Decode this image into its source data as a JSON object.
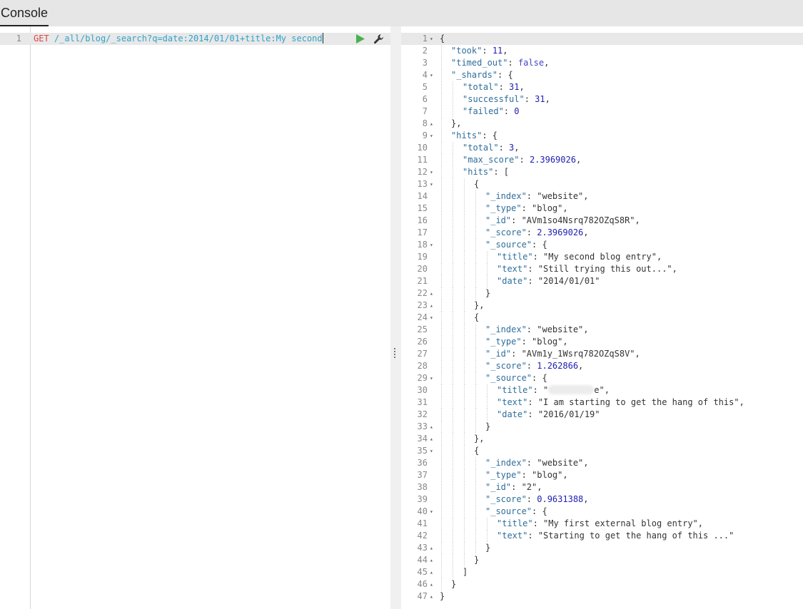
{
  "header": {
    "tab_label": "Console"
  },
  "request": {
    "line_number": "1",
    "method": "GET",
    "url": "/_all/blog/_search?q=date:2014/01/01+title:My second",
    "run_icon": "play-icon",
    "settings_icon": "wrench-icon"
  },
  "response": {
    "lines": [
      {
        "n": "1",
        "fold": "▾",
        "depth": 0,
        "tokens": [
          {
            "t": "p",
            "v": "{"
          }
        ]
      },
      {
        "n": "2",
        "depth": 1,
        "tokens": [
          {
            "t": "k",
            "v": "\"took\""
          },
          {
            "t": "p",
            "v": ": "
          },
          {
            "t": "n",
            "v": "11"
          },
          {
            "t": "p",
            "v": ","
          }
        ]
      },
      {
        "n": "3",
        "depth": 1,
        "tokens": [
          {
            "t": "k",
            "v": "\"timed_out\""
          },
          {
            "t": "p",
            "v": ": "
          },
          {
            "t": "b",
            "v": "false"
          },
          {
            "t": "p",
            "v": ","
          }
        ]
      },
      {
        "n": "4",
        "fold": "▾",
        "depth": 1,
        "tokens": [
          {
            "t": "k",
            "v": "\"_shards\""
          },
          {
            "t": "p",
            "v": ": {"
          }
        ]
      },
      {
        "n": "5",
        "depth": 2,
        "tokens": [
          {
            "t": "k",
            "v": "\"total\""
          },
          {
            "t": "p",
            "v": ": "
          },
          {
            "t": "n",
            "v": "31"
          },
          {
            "t": "p",
            "v": ","
          }
        ]
      },
      {
        "n": "6",
        "depth": 2,
        "tokens": [
          {
            "t": "k",
            "v": "\"successful\""
          },
          {
            "t": "p",
            "v": ": "
          },
          {
            "t": "n",
            "v": "31"
          },
          {
            "t": "p",
            "v": ","
          }
        ]
      },
      {
        "n": "7",
        "depth": 2,
        "tokens": [
          {
            "t": "k",
            "v": "\"failed\""
          },
          {
            "t": "p",
            "v": ": "
          },
          {
            "t": "n",
            "v": "0"
          }
        ]
      },
      {
        "n": "8",
        "fold": "▴",
        "depth": 1,
        "tokens": [
          {
            "t": "p",
            "v": "},"
          }
        ]
      },
      {
        "n": "9",
        "fold": "▾",
        "depth": 1,
        "tokens": [
          {
            "t": "k",
            "v": "\"hits\""
          },
          {
            "t": "p",
            "v": ": {"
          }
        ]
      },
      {
        "n": "10",
        "depth": 2,
        "tokens": [
          {
            "t": "k",
            "v": "\"total\""
          },
          {
            "t": "p",
            "v": ": "
          },
          {
            "t": "n",
            "v": "3"
          },
          {
            "t": "p",
            "v": ","
          }
        ]
      },
      {
        "n": "11",
        "depth": 2,
        "tokens": [
          {
            "t": "k",
            "v": "\"max_score\""
          },
          {
            "t": "p",
            "v": ": "
          },
          {
            "t": "n",
            "v": "2.3969026"
          },
          {
            "t": "p",
            "v": ","
          }
        ]
      },
      {
        "n": "12",
        "fold": "▾",
        "depth": 2,
        "tokens": [
          {
            "t": "k",
            "v": "\"hits\""
          },
          {
            "t": "p",
            "v": ": ["
          }
        ]
      },
      {
        "n": "13",
        "fold": "▾",
        "depth": 3,
        "tokens": [
          {
            "t": "p",
            "v": "{"
          }
        ]
      },
      {
        "n": "14",
        "depth": 4,
        "tokens": [
          {
            "t": "k",
            "v": "\"_index\""
          },
          {
            "t": "p",
            "v": ": "
          },
          {
            "t": "s",
            "v": "\"website\""
          },
          {
            "t": "p",
            "v": ","
          }
        ]
      },
      {
        "n": "15",
        "depth": 4,
        "tokens": [
          {
            "t": "k",
            "v": "\"_type\""
          },
          {
            "t": "p",
            "v": ": "
          },
          {
            "t": "s",
            "v": "\"blog\""
          },
          {
            "t": "p",
            "v": ","
          }
        ]
      },
      {
        "n": "16",
        "depth": 4,
        "tokens": [
          {
            "t": "k",
            "v": "\"_id\""
          },
          {
            "t": "p",
            "v": ": "
          },
          {
            "t": "s",
            "v": "\"AVm1so4Nsrq782OZqS8R\""
          },
          {
            "t": "p",
            "v": ","
          }
        ]
      },
      {
        "n": "17",
        "depth": 4,
        "tokens": [
          {
            "t": "k",
            "v": "\"_score\""
          },
          {
            "t": "p",
            "v": ": "
          },
          {
            "t": "n",
            "v": "2.3969026"
          },
          {
            "t": "p",
            "v": ","
          }
        ]
      },
      {
        "n": "18",
        "fold": "▾",
        "depth": 4,
        "tokens": [
          {
            "t": "k",
            "v": "\"_source\""
          },
          {
            "t": "p",
            "v": ": {"
          }
        ]
      },
      {
        "n": "19",
        "depth": 5,
        "tokens": [
          {
            "t": "k",
            "v": "\"title\""
          },
          {
            "t": "p",
            "v": ": "
          },
          {
            "t": "s",
            "v": "\"My second blog entry\""
          },
          {
            "t": "p",
            "v": ","
          }
        ]
      },
      {
        "n": "20",
        "depth": 5,
        "tokens": [
          {
            "t": "k",
            "v": "\"text\""
          },
          {
            "t": "p",
            "v": ": "
          },
          {
            "t": "s",
            "v": "\"Still trying this out...\""
          },
          {
            "t": "p",
            "v": ","
          }
        ]
      },
      {
        "n": "21",
        "depth": 5,
        "tokens": [
          {
            "t": "k",
            "v": "\"date\""
          },
          {
            "t": "p",
            "v": ": "
          },
          {
            "t": "s",
            "v": "\"2014/01/01\""
          }
        ]
      },
      {
        "n": "22",
        "fold": "▴",
        "depth": 4,
        "tokens": [
          {
            "t": "p",
            "v": "}"
          }
        ]
      },
      {
        "n": "23",
        "fold": "▴",
        "depth": 3,
        "tokens": [
          {
            "t": "p",
            "v": "},"
          }
        ]
      },
      {
        "n": "24",
        "fold": "▾",
        "depth": 3,
        "tokens": [
          {
            "t": "p",
            "v": "{"
          }
        ]
      },
      {
        "n": "25",
        "depth": 4,
        "tokens": [
          {
            "t": "k",
            "v": "\"_index\""
          },
          {
            "t": "p",
            "v": ": "
          },
          {
            "t": "s",
            "v": "\"website\""
          },
          {
            "t": "p",
            "v": ","
          }
        ]
      },
      {
        "n": "26",
        "depth": 4,
        "tokens": [
          {
            "t": "k",
            "v": "\"_type\""
          },
          {
            "t": "p",
            "v": ": "
          },
          {
            "t": "s",
            "v": "\"blog\""
          },
          {
            "t": "p",
            "v": ","
          }
        ]
      },
      {
        "n": "27",
        "depth": 4,
        "tokens": [
          {
            "t": "k",
            "v": "\"_id\""
          },
          {
            "t": "p",
            "v": ": "
          },
          {
            "t": "s",
            "v": "\"AVm1y_1Wsrq782OZqS8V\""
          },
          {
            "t": "p",
            "v": ","
          }
        ]
      },
      {
        "n": "28",
        "depth": 4,
        "tokens": [
          {
            "t": "k",
            "v": "\"_score\""
          },
          {
            "t": "p",
            "v": ": "
          },
          {
            "t": "n",
            "v": "1.262866"
          },
          {
            "t": "p",
            "v": ","
          }
        ]
      },
      {
        "n": "29",
        "fold": "▾",
        "depth": 4,
        "tokens": [
          {
            "t": "k",
            "v": "\"_source\""
          },
          {
            "t": "p",
            "v": ": {"
          }
        ]
      },
      {
        "n": "30",
        "depth": 5,
        "tokens": [
          {
            "t": "k",
            "v": "\"title\""
          },
          {
            "t": "p",
            "v": ": "
          },
          {
            "t": "s",
            "v": "\""
          },
          {
            "t": "r",
            "v": ""
          },
          {
            "t": "s",
            "v": "e\""
          },
          {
            "t": "p",
            "v": ","
          }
        ]
      },
      {
        "n": "31",
        "depth": 5,
        "tokens": [
          {
            "t": "k",
            "v": "\"text\""
          },
          {
            "t": "p",
            "v": ": "
          },
          {
            "t": "s",
            "v": "\"I am starting to get the hang of this\""
          },
          {
            "t": "p",
            "v": ","
          }
        ]
      },
      {
        "n": "32",
        "depth": 5,
        "tokens": [
          {
            "t": "k",
            "v": "\"date\""
          },
          {
            "t": "p",
            "v": ": "
          },
          {
            "t": "s",
            "v": "\"2016/01/19\""
          }
        ]
      },
      {
        "n": "33",
        "fold": "▴",
        "depth": 4,
        "tokens": [
          {
            "t": "p",
            "v": "}"
          }
        ]
      },
      {
        "n": "34",
        "fold": "▴",
        "depth": 3,
        "tokens": [
          {
            "t": "p",
            "v": "},"
          }
        ]
      },
      {
        "n": "35",
        "fold": "▾",
        "depth": 3,
        "tokens": [
          {
            "t": "p",
            "v": "{"
          }
        ]
      },
      {
        "n": "36",
        "depth": 4,
        "tokens": [
          {
            "t": "k",
            "v": "\"_index\""
          },
          {
            "t": "p",
            "v": ": "
          },
          {
            "t": "s",
            "v": "\"website\""
          },
          {
            "t": "p",
            "v": ","
          }
        ]
      },
      {
        "n": "37",
        "depth": 4,
        "tokens": [
          {
            "t": "k",
            "v": "\"_type\""
          },
          {
            "t": "p",
            "v": ": "
          },
          {
            "t": "s",
            "v": "\"blog\""
          },
          {
            "t": "p",
            "v": ","
          }
        ]
      },
      {
        "n": "38",
        "depth": 4,
        "tokens": [
          {
            "t": "k",
            "v": "\"_id\""
          },
          {
            "t": "p",
            "v": ": "
          },
          {
            "t": "s",
            "v": "\"2\""
          },
          {
            "t": "p",
            "v": ","
          }
        ]
      },
      {
        "n": "39",
        "depth": 4,
        "tokens": [
          {
            "t": "k",
            "v": "\"_score\""
          },
          {
            "t": "p",
            "v": ": "
          },
          {
            "t": "n",
            "v": "0.9631388"
          },
          {
            "t": "p",
            "v": ","
          }
        ]
      },
      {
        "n": "40",
        "fold": "▾",
        "depth": 4,
        "tokens": [
          {
            "t": "k",
            "v": "\"_source\""
          },
          {
            "t": "p",
            "v": ": {"
          }
        ]
      },
      {
        "n": "41",
        "depth": 5,
        "tokens": [
          {
            "t": "k",
            "v": "\"title\""
          },
          {
            "t": "p",
            "v": ": "
          },
          {
            "t": "s",
            "v": "\"My first external blog entry\""
          },
          {
            "t": "p",
            "v": ","
          }
        ]
      },
      {
        "n": "42",
        "depth": 5,
        "tokens": [
          {
            "t": "k",
            "v": "\"text\""
          },
          {
            "t": "p",
            "v": ": "
          },
          {
            "t": "s",
            "v": "\"Starting to get the hang of this ...\""
          }
        ]
      },
      {
        "n": "43",
        "fold": "▴",
        "depth": 4,
        "tokens": [
          {
            "t": "p",
            "v": "}"
          }
        ]
      },
      {
        "n": "44",
        "fold": "▴",
        "depth": 3,
        "tokens": [
          {
            "t": "p",
            "v": "}"
          }
        ]
      },
      {
        "n": "45",
        "fold": "▴",
        "depth": 2,
        "tokens": [
          {
            "t": "p",
            "v": "]"
          }
        ]
      },
      {
        "n": "46",
        "fold": "▴",
        "depth": 1,
        "tokens": [
          {
            "t": "p",
            "v": "}"
          }
        ]
      },
      {
        "n": "47",
        "fold": "▴",
        "depth": 0,
        "tokens": [
          {
            "t": "p",
            "v": "}"
          }
        ]
      }
    ]
  },
  "colors": {
    "header_bg": "#e6e6e6",
    "method": "#e04444",
    "url": "#2ea3c9",
    "json_key": "#2e6e9b",
    "json_number": "#1d1db3",
    "json_boolean": "#4545c8",
    "run_button": "#4caf50"
  }
}
